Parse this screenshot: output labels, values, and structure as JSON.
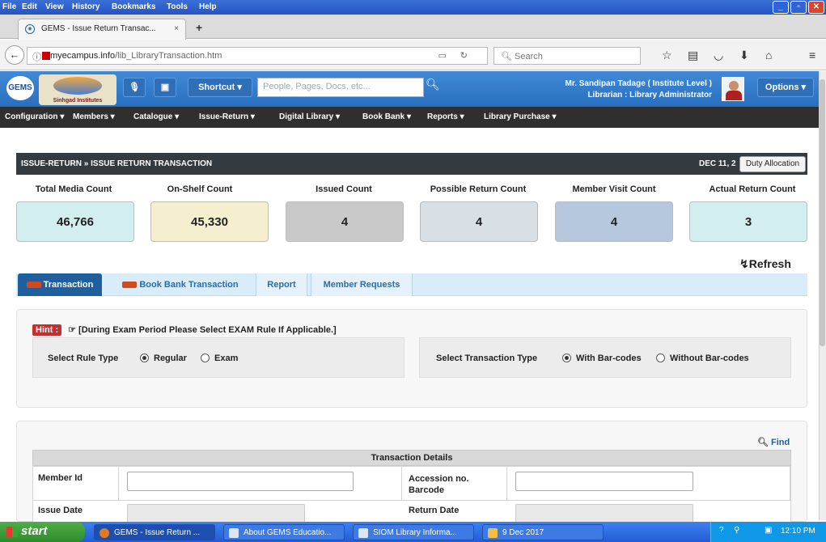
{
  "browser": {
    "menu": [
      "File",
      "Edit",
      "View",
      "History",
      "Bookmarks",
      "Tools",
      "Help"
    ],
    "tab_title": "GEMS - Issue Return Transac...",
    "tab_close": "×",
    "new_tab": "+",
    "url_domain": "myecampus.info",
    "url_path": "/lib_LibraryTransaction.htm",
    "search_placeholder": "Search"
  },
  "header": {
    "logo_text": "GEMS",
    "institute_text": "Sinhgad Institutes",
    "shortcut_label": "Shortcut",
    "search_placeholder": "People, Pages, Docs, etc...",
    "user_name": "Mr. Sandipan Tadage ( Institute Level )",
    "user_role": "Librarian : Library Administrator",
    "options_label": "Options"
  },
  "nav": {
    "items": [
      "Configuration",
      "Members",
      "Catalogue",
      "Issue-Return",
      "Digital Library",
      "Book Bank",
      "Reports",
      "Library Purchase"
    ]
  },
  "page": {
    "breadcrumb": "ISSUE-RETURN » ISSUE RETURN TRANSACTION",
    "date": "DEC 11, 2",
    "tooltip": "Duty Allocation",
    "refresh_label": "Refresh"
  },
  "stats": [
    {
      "label": "Total Media Count",
      "value": "46,766",
      "color": "#d3eeee"
    },
    {
      "label": "On-Shelf Count",
      "value": "45,330",
      "color": "#f6efcf"
    },
    {
      "label": "Issued Count",
      "value": "4",
      "color": "#c9c9c9"
    },
    {
      "label": "Possible Return Count",
      "value": "4",
      "color": "#d8dfe5"
    },
    {
      "label": "Member Visit Count",
      "value": "4",
      "color": "#b6c8dd"
    },
    {
      "label": "Actual Return Count",
      "value": "3",
      "color": "#d3eeee"
    }
  ],
  "tabs": [
    "Transaction",
    "Book Bank Transaction",
    "Report",
    "Member Requests"
  ],
  "hint": {
    "badge": "Hint :",
    "text": "[During Exam Period Please Select EXAM Rule If Applicable.]"
  },
  "rule_type": {
    "label": "Select Rule Type",
    "options": [
      "Regular",
      "Exam"
    ],
    "selected": "Regular"
  },
  "transaction_type": {
    "label": "Select Transaction Type",
    "options": [
      "With Bar-codes",
      "Without Bar-codes"
    ],
    "selected": "With Bar-codes"
  },
  "details": {
    "find_label": "Find",
    "header": "Transaction Details",
    "member_id_label": "Member Id",
    "accession_label_line1": "Accession no.",
    "accession_label_line2": "Barcode",
    "issue_date_label": "Issue Date",
    "return_date_label": "Return Date"
  },
  "taskbar": {
    "start_label": "start",
    "tasks": [
      "GEMS - Issue Return ...",
      "About GEMS Educatio...",
      "SIOM Library Informa...",
      "9 Dec 2017"
    ],
    "time": "12:10 PM"
  }
}
